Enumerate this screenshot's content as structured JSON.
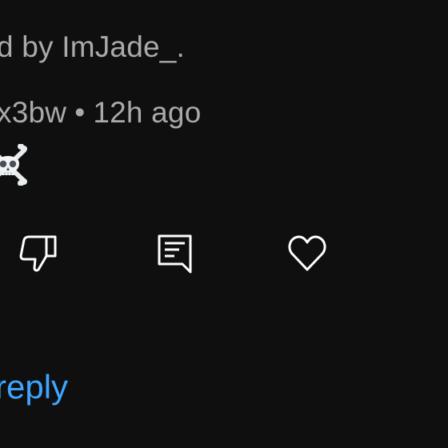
{
  "comment": {
    "liked_by_text": "d by ImJade_.",
    "author_fragment": "x3bw",
    "separator": "•",
    "timestamp": "12h ago",
    "body_icon": "skull-crossbones-emoji"
  },
  "actions": {
    "dislike_icon": "thumbs-down-icon",
    "reply_icon": "reply-comment-icon",
    "like_icon": "heart-icon",
    "reply_label": "reply"
  },
  "colors": {
    "background": "#0f0f0f",
    "text": "#aaaaaa",
    "icon": "#ffffff",
    "link": "#3ea6ff"
  }
}
